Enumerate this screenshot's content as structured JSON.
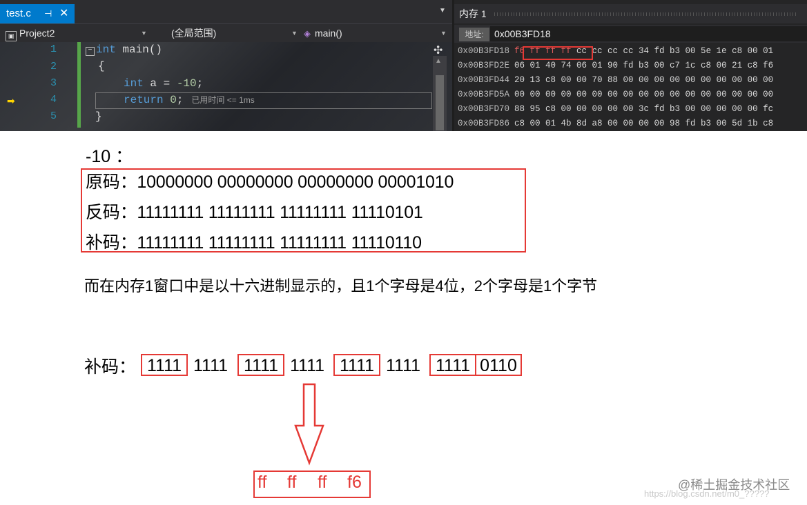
{
  "ide": {
    "file_tab": {
      "name": "test.c",
      "pin": "⊣",
      "close": "✕"
    },
    "tab_dropdown": "▼",
    "navbar": {
      "project": "Project2",
      "scope": "(全局范围)",
      "function": "main()",
      "chevron": "▼"
    },
    "line_numbers": [
      "1",
      "2",
      "3",
      "4",
      "5"
    ],
    "code": {
      "line1_kw": "int",
      "line1_rest": " main()",
      "line2": "{",
      "line3_kw": "int",
      "line3_a": " a = ",
      "line3_num": "-10",
      "line3_end": ";",
      "line4_kw": "return",
      "line4_num": " 0",
      "line4_end": ";",
      "line4_elapsed": "已用时间 <= 1ms",
      "line5": "}"
    },
    "icons": {
      "exec_arrow": "yellow-arrow-icon",
      "fold": "collapse-icon",
      "split": "split-icon"
    }
  },
  "memory": {
    "title": "内存 1",
    "address_label": "地址:",
    "address_value": "0x00B3FD18",
    "rows": [
      {
        "addr": "0x00B3FD18",
        "highlight": "f6 ff ff ff",
        "bytes": " cc cc cc cc 34 fd b3 00 5e 1e c8 00 01"
      },
      {
        "addr": "0x00B3FD2E",
        "highlight": "",
        "bytes": "06 01 40 74 06 01 90 fd b3 00 c7 1c c8 00 21 c8 f6"
      },
      {
        "addr": "0x00B3FD44",
        "highlight": "",
        "bytes": "20 13 c8 00 00 70 88 00 00 00 00 00 00 00 00 00 00"
      },
      {
        "addr": "0x00B3FD5A",
        "highlight": "",
        "bytes": "00 00 00 00 00 00 00 00 00 00 00 00 00 00 00 00 00"
      },
      {
        "addr": "0x00B3FD70",
        "highlight": "",
        "bytes": "88 95 c8 00 00 00 00 00 3c fd b3 00 00 00 00 00 fc"
      },
      {
        "addr": "0x00B3FD86",
        "highlight": "",
        "bytes": "c8 00 01 4b 8d a8 00 00 00 00 98 fd b3 00 5d 1b c8"
      }
    ]
  },
  "explanation": {
    "value": "-10 ：",
    "yuanma": "原码：10000000 00000000 00000000 00001010",
    "fanma": "反码：11111111 11111111 11111111 11110101",
    "buma": "补码：11111111 11111111 11111111 11110110",
    "sentence": "而在内存1窗口中是以十六进制显示的，且1个字母是4位，2个字母是1个字节",
    "buma_label": "补码：",
    "nibbles": [
      "1111",
      "1111",
      "1111",
      "1111",
      "1111",
      "1111",
      "1111",
      "0110"
    ],
    "hex_bytes": [
      "ff",
      "ff",
      "ff",
      "f6"
    ],
    "watermark": "@稀土掘金技术社区",
    "watermark_url": "https://blog.csdn.net/m0_?????"
  },
  "colors": {
    "accent_red": "#e53935",
    "tab_blue": "#007acc",
    "keyword_blue": "#569cd6"
  }
}
